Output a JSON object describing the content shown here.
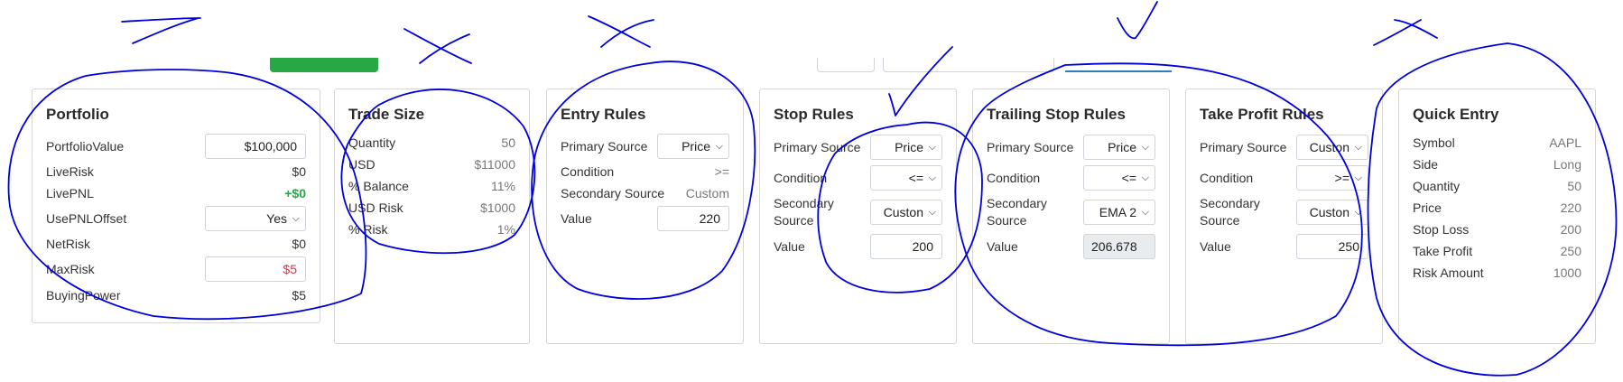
{
  "portfolio": {
    "title": "Portfolio",
    "portfolio_value_label": "PortfolioValue",
    "portfolio_value": "$100,000",
    "live_risk_label": "LiveRisk",
    "live_risk": "$0",
    "live_pnl_label": "LivePNL",
    "live_pnl": "+$0",
    "use_pnl_offset_label": "UsePNLOffset",
    "use_pnl_offset": "Yes",
    "net_risk_label": "NetRisk",
    "net_risk": "$0",
    "max_risk_label": "MaxRisk",
    "max_risk": "$5",
    "buying_power_label": "BuyingPower",
    "buying_power": "$5"
  },
  "trade_size": {
    "title": "Trade Size",
    "quantity_label": "Quantity",
    "quantity": "50",
    "usd_label": "USD",
    "usd": "$11000",
    "balance_label": "% Balance",
    "balance": "11%",
    "usd_risk_label": "USD Risk",
    "usd_risk": "$1000",
    "risk_label": "% Risk",
    "risk": "1%"
  },
  "entry_rules": {
    "title": "Entry Rules",
    "primary_source_label": "Primary Source",
    "primary_source": "Price",
    "condition_label": "Condition",
    "condition": ">=",
    "secondary_source_label": "Secondary Source",
    "secondary_source": "Custom",
    "value_label": "Value",
    "value": "220"
  },
  "stop_rules": {
    "title": "Stop Rules",
    "primary_source_label": "Primary Source",
    "primary_source": "Price",
    "condition_label": "Condition",
    "condition": "<=",
    "secondary_source_label_1": "Secondary",
    "secondary_source_label_2": "Source",
    "secondary_source": "Custon",
    "value_label": "Value",
    "value": "200"
  },
  "trailing_stop_rules": {
    "title": "Trailing Stop Rules",
    "primary_source_label": "Primary Source",
    "primary_source": "Price",
    "condition_label": "Condition",
    "condition": "<=",
    "secondary_source_label_1": "Secondary",
    "secondary_source_label_2": "Source",
    "secondary_source": "EMA 2",
    "value_label": "Value",
    "value": "206.678"
  },
  "take_profit_rules": {
    "title": "Take Profit Rules",
    "primary_source_label": "Primary Source",
    "primary_source": "Custon",
    "condition_label": "Condition",
    "condition": ">=",
    "secondary_source_label_1": "Secondary",
    "secondary_source_label_2": "Source",
    "secondary_source": "Custon",
    "value_label": "Value",
    "value": "250"
  },
  "quick_entry": {
    "title": "Quick Entry",
    "symbol_label": "Symbol",
    "symbol": "AAPL",
    "side_label": "Side",
    "side": "Long",
    "quantity_label": "Quantity",
    "quantity": "50",
    "price_label": "Price",
    "price": "220",
    "stop_loss_label": "Stop Loss",
    "stop_loss": "200",
    "take_profit_label": "Take Profit",
    "take_profit": "250",
    "risk_amount_label": "Risk Amount",
    "risk_amount": "1000"
  },
  "colors": {
    "accent_green": "#28a745",
    "danger_red": "#dc3545",
    "annotation_blue": "#0000dd",
    "card_border": "#d6d6d6"
  },
  "icons": {
    "select_chevron": "chevron-down-icon"
  }
}
